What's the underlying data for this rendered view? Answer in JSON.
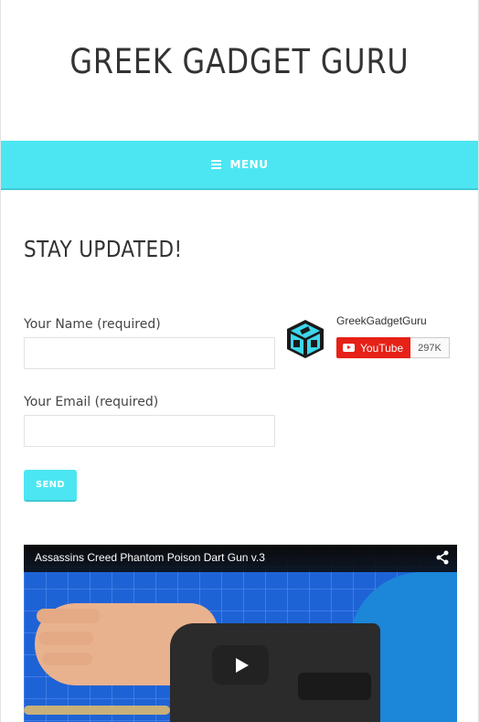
{
  "site": {
    "title": "GREEK GADGET GURU"
  },
  "nav": {
    "menu_label": "MENU",
    "menu_icon": "hamburger-icon"
  },
  "colors": {
    "accent": "#4ce6f2",
    "youtube_red": "#e62117",
    "video_bg": "#1e63d6"
  },
  "subscribe_form": {
    "heading": "STAY UPDATED!",
    "name_label": "Your Name (required)",
    "name_value": "",
    "email_label": "Your Email (required)",
    "email_value": "",
    "send_label": "SEND"
  },
  "youtube_widget": {
    "channel_name": "GreekGadgetGuru",
    "button_label": "YouTube",
    "subscriber_count": "297K",
    "logo_icon": "ggg-logo"
  },
  "video": {
    "title": "Assassins Creed Phantom Poison Dart Gun v.3",
    "share_icon": "share-icon",
    "play_icon": "play-icon"
  }
}
